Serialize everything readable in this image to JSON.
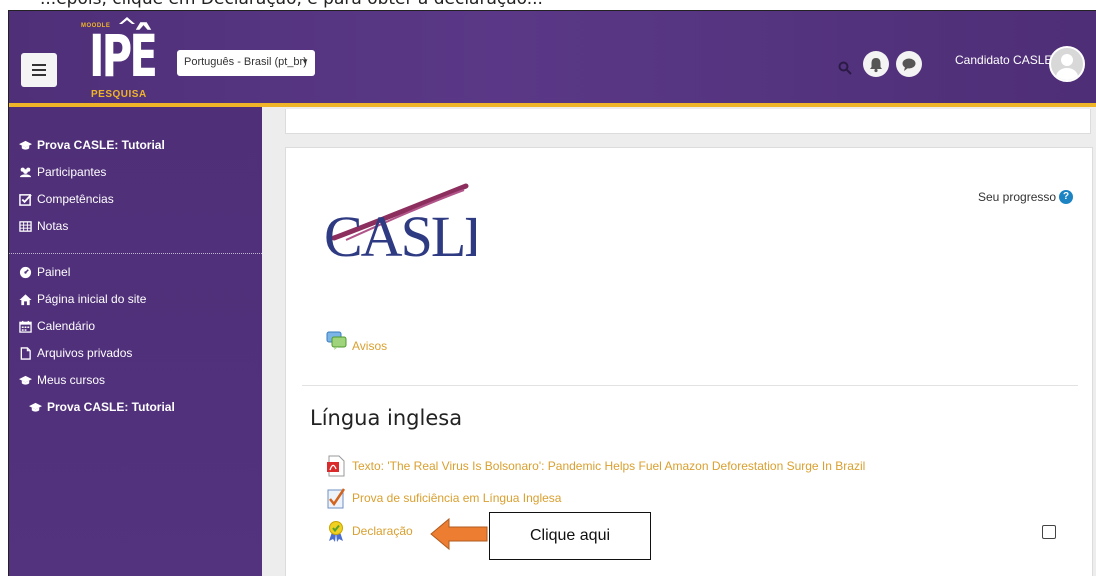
{
  "caption": "...epois, clique em Declaração, e para obter a declaração...",
  "navbar": {
    "menu_icon": "hamburger-icon",
    "logo": {
      "top": "MOODLE",
      "main": "IPÊ",
      "sub": "PESQUISA"
    },
    "language": "Português - Brasil (pt_br)",
    "user_name": "Candidato CASLE",
    "icons": [
      "search-icon",
      "bell-icon",
      "chat-icon",
      "avatar"
    ]
  },
  "sidebar": {
    "group1": [
      {
        "label": "Prova CASLE: Tutorial",
        "icon": "graduation-cap-icon",
        "bold": true
      },
      {
        "label": "Participantes",
        "icon": "users-icon"
      },
      {
        "label": "Competências",
        "icon": "check-square-icon"
      },
      {
        "label": "Notas",
        "icon": "table-icon"
      }
    ],
    "group2": [
      {
        "label": "Painel",
        "icon": "dashboard-icon"
      },
      {
        "label": "Página inicial do site",
        "icon": "home-icon"
      },
      {
        "label": "Calendário",
        "icon": "calendar-icon"
      },
      {
        "label": "Arquivos privados",
        "icon": "file-icon"
      },
      {
        "label": "Meus cursos",
        "icon": "graduation-cap-icon"
      },
      {
        "label": "Prova CASLE: Tutorial",
        "icon": "graduation-cap-icon",
        "bold": true
      }
    ]
  },
  "course": {
    "logo_text": "CASLE",
    "progress_label": "Seu progresso",
    "announcements": "Avisos",
    "section_title": "Língua inglesa",
    "activities": [
      {
        "label": "Texto: 'The Real Virus Is Bolsonaro': Pandemic Helps Fuel Amazon Deforestation Surge In Brazil",
        "icon": "pdf-icon"
      },
      {
        "label": "Prova de suficiência em Língua Inglesa",
        "icon": "quiz-icon"
      },
      {
        "label": "Declaração",
        "icon": "certificate-icon"
      }
    ]
  },
  "annotation": {
    "label": "Clique aqui",
    "color": "#ed7d31"
  },
  "colors": {
    "navbar": "#53327e",
    "accent": "#f0b429",
    "link": "#d9a030",
    "help": "#1d84c4"
  }
}
